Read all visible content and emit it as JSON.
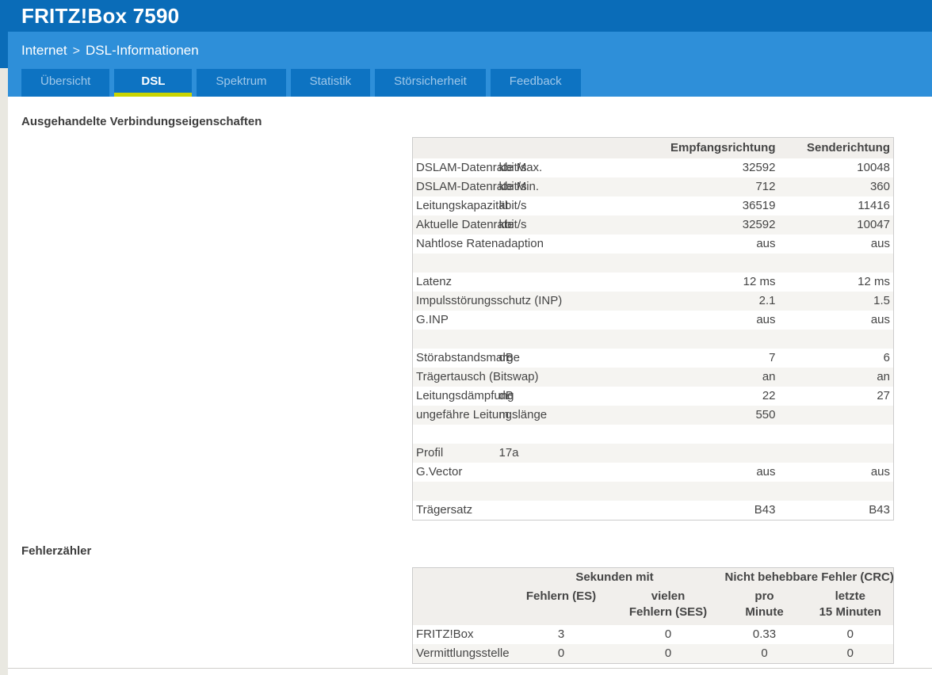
{
  "app": {
    "title": "FRITZ!Box 7590"
  },
  "breadcrumb": {
    "items": [
      "Internet",
      "DSL-Informationen"
    ],
    "separator": ">"
  },
  "tabs": [
    {
      "label": "Übersicht",
      "active": false
    },
    {
      "label": "DSL",
      "active": true
    },
    {
      "label": "Spektrum",
      "active": false
    },
    {
      "label": "Statistik",
      "active": false
    },
    {
      "label": "Störsicherheit",
      "active": false
    },
    {
      "label": "Feedback",
      "active": false
    }
  ],
  "sections": {
    "connection": {
      "title": "Ausgehandelte Verbindungseigenschaften"
    },
    "errors": {
      "title": "Fehlerzähler"
    }
  },
  "connection_table": {
    "col_headers": [
      "",
      "",
      "Empfangsrichtung",
      "Senderichtung"
    ],
    "rows": [
      {
        "label": "DSLAM-Datenrate Max.",
        "unit": "kbit/s",
        "rx": "32592",
        "tx": "10048"
      },
      {
        "label": "DSLAM-Datenrate Min.",
        "unit": "kbit/s",
        "rx": "712",
        "tx": "360"
      },
      {
        "label": "Leitungskapazität",
        "unit": "kbit/s",
        "rx": "36519",
        "tx": "11416"
      },
      {
        "label": "Aktuelle Datenrate",
        "unit": "kbit/s",
        "rx": "32592",
        "tx": "10047"
      },
      {
        "label": "Nahtlose Ratenadaption",
        "unit": "",
        "rx": "aus",
        "tx": "aus"
      },
      {
        "spacer": true
      },
      {
        "label": "Latenz",
        "unit": "",
        "rx": "12 ms",
        "tx": "12 ms"
      },
      {
        "label": "Impulsstörungsschutz (INP)",
        "unit": "",
        "rx": "2.1",
        "tx": "1.5"
      },
      {
        "label": "G.INP",
        "unit": "",
        "rx": "aus",
        "tx": "aus"
      },
      {
        "spacer": true
      },
      {
        "label": "Störabstandsmarge",
        "unit": "dB",
        "rx": "7",
        "tx": "6"
      },
      {
        "label": "Trägertausch (Bitswap)",
        "unit": "",
        "rx": "an",
        "tx": "an"
      },
      {
        "label": "Leitungsdämpfung",
        "unit": "dB",
        "rx": "22",
        "tx": "27"
      },
      {
        "label": "ungefähre Leitungslänge",
        "unit": "m",
        "rx": "550",
        "tx": ""
      },
      {
        "spacer": true
      },
      {
        "label": "Profil",
        "unit": "17a",
        "rx": "",
        "tx": ""
      },
      {
        "label": "G.Vector",
        "unit": "",
        "rx": "aus",
        "tx": "aus"
      },
      {
        "spacer": true
      },
      {
        "label": "Trägersatz",
        "unit": "",
        "rx": "B43",
        "tx": "B43"
      }
    ]
  },
  "error_table": {
    "group_headers": [
      {
        "label": "",
        "span": 1
      },
      {
        "label": "Sekunden mit",
        "span": 2
      },
      {
        "label": "Nicht behebbare Fehler (CRC)",
        "span": 2
      }
    ],
    "sub_headers": [
      {
        "lines": [
          "Fehlern (ES)"
        ]
      },
      {
        "lines": [
          "vielen",
          "Fehlern (SES)"
        ]
      },
      {
        "lines": [
          "pro",
          "Minute"
        ]
      },
      {
        "lines": [
          "letzte",
          "15 Minuten"
        ]
      }
    ],
    "rows": [
      {
        "label": "FRITZ!Box",
        "values": [
          "3",
          "0",
          "0.33",
          "0"
        ]
      },
      {
        "label": "Vermittlungsstelle",
        "values": [
          "0",
          "0",
          "0",
          "0"
        ]
      }
    ]
  },
  "colors": {
    "brand_bar": "#0a6cb8",
    "band": "#2e8fd9",
    "tab_bg": "#0d73c2",
    "tab_active_underline": "#c9d400",
    "tab_inactive_text": "#9fc8ea",
    "page_bg": "#e9e8e1",
    "zebra": "#f5f4f1",
    "table_header_bg": "#f1efec",
    "table_border": "#cccccc",
    "text": "#454545",
    "divider": "#cfcecb"
  }
}
